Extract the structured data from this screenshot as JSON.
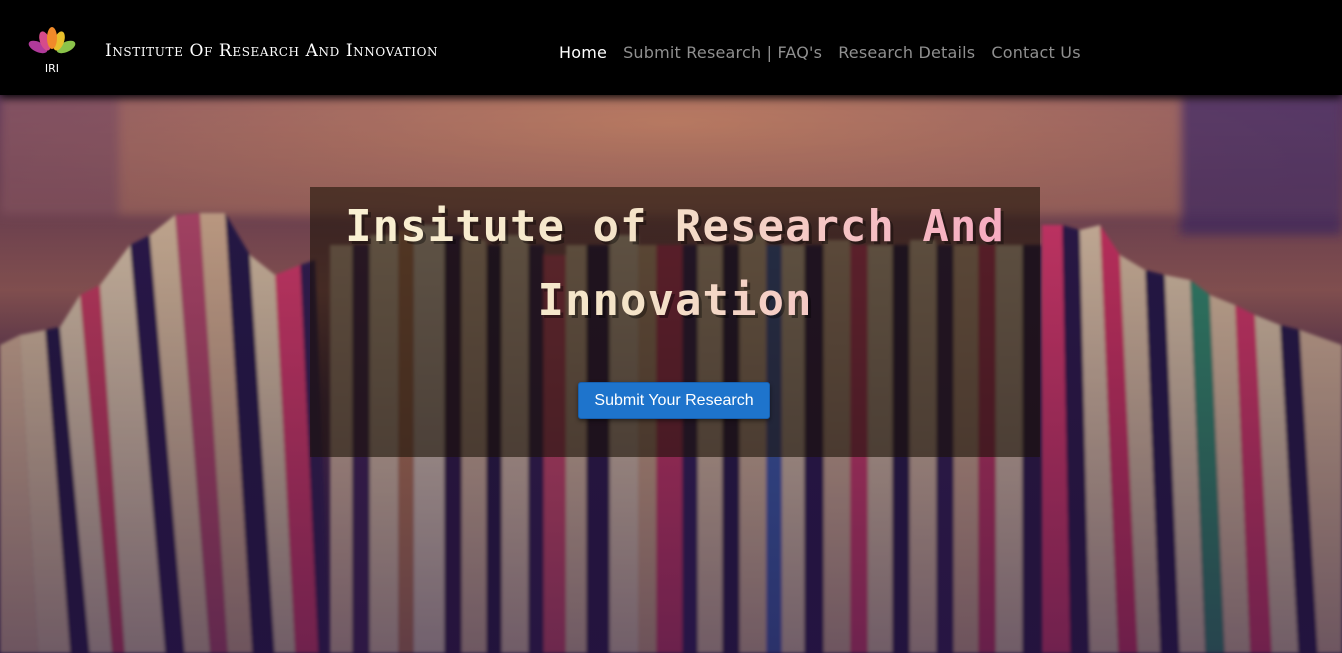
{
  "header": {
    "logo_text": "IRI",
    "brand": "Institute Of Research And Innovation",
    "nav": [
      {
        "label": "Home",
        "active": true
      },
      {
        "label": "Submit Research | FAQ's",
        "active": false
      },
      {
        "label": "Research Details",
        "active": false
      },
      {
        "label": "Contact Us",
        "active": false
      }
    ]
  },
  "hero": {
    "title": "Insitute of Research And Innovation",
    "cta_label": "Submit Your Research",
    "background": "blurred-books-photo"
  },
  "colors": {
    "navbar_bg": "#000000",
    "nav_active": "#ffffff",
    "nav_inactive": "#8f8f8f",
    "cta_bg": "#1e74cc"
  }
}
